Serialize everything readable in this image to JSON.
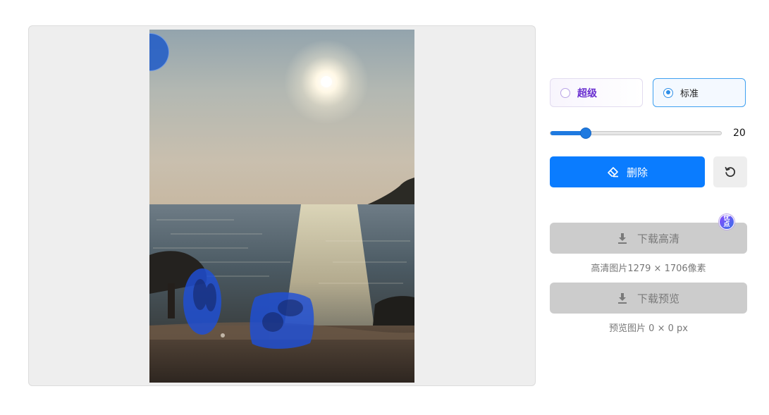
{
  "editor": {
    "brush_size": 20,
    "brush_size_text": "20"
  },
  "modes": {
    "super_label": "超级",
    "standard_label": "标准",
    "selected": "standard"
  },
  "actions": {
    "delete_label": "删除",
    "reset_icon": "rotate-ccw-icon",
    "erase_icon": "eraser-icon"
  },
  "downloads": {
    "hd_label": "下载高清",
    "hd_caption": "高清图片1279 × 1706像素",
    "hd_badge": "优\n点",
    "preview_label": "下载预览",
    "preview_caption": "预览图片 0 × 0 px",
    "download_icon": "download-icon"
  },
  "colors": {
    "primary": "#0a7cff",
    "super_accent": "#6a2fd0",
    "disabled_bg": "#cccccc",
    "mask": "#1e4fd8"
  }
}
